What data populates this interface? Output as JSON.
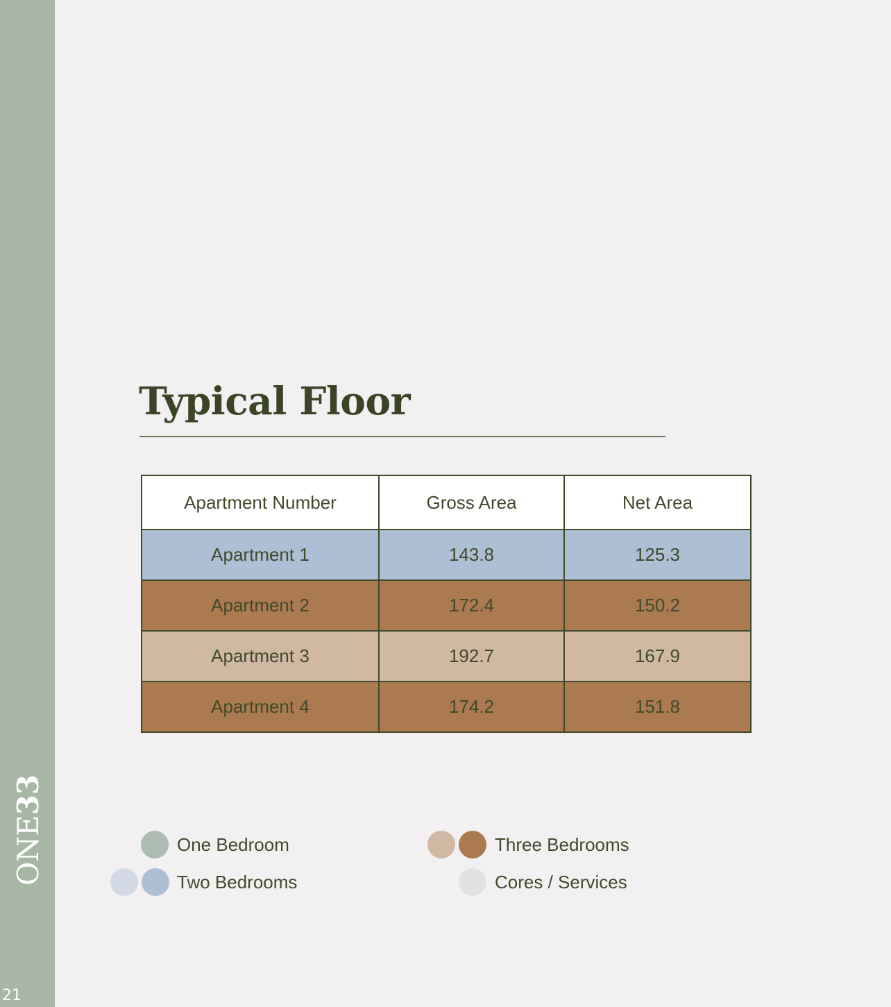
{
  "brand": {
    "prefix": "ONE",
    "suffix": "33"
  },
  "page_number": "21",
  "title": "Typical Floor",
  "table": {
    "headers": [
      "Apartment Number",
      "Gross Area",
      "Net Area"
    ],
    "rows": [
      {
        "apartment": "Apartment 1",
        "gross": "143.8",
        "net": "125.3",
        "color": "#adbfd4"
      },
      {
        "apartment": "Apartment 2",
        "gross": "172.4",
        "net": "150.2",
        "color": "#ab7a50"
      },
      {
        "apartment": "Apartment 3",
        "gross": "192.7",
        "net": "167.9",
        "color": "#d0b8a3"
      },
      {
        "apartment": "Apartment 4",
        "gross": "174.2",
        "net": "151.8",
        "color": "#ab7a50"
      }
    ]
  },
  "legend": {
    "one_bedroom": {
      "label": "One Bedroom",
      "colors": [
        "#adbcb2"
      ]
    },
    "two_bedrooms": {
      "label": "Two Bedrooms",
      "colors": [
        "#d2d8e4",
        "#adbfd4"
      ]
    },
    "three_bedrooms": {
      "label": "Three Bedrooms",
      "colors": [
        "#d0b8a3",
        "#ab7a50"
      ]
    },
    "cores_services": {
      "label": "Cores / Services",
      "colors": [
        "#e2e1e2"
      ]
    }
  }
}
